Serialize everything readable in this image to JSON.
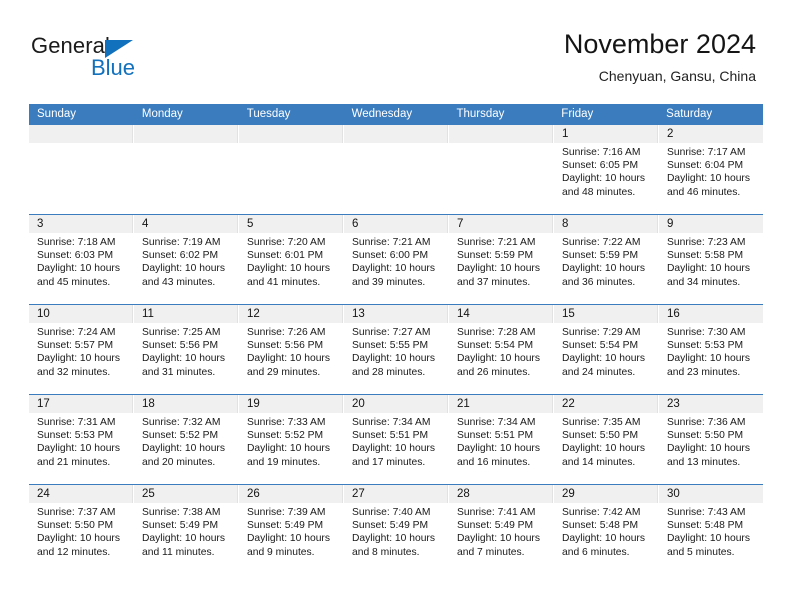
{
  "brand": {
    "name_part1": "General",
    "name_part2": "Blue",
    "accent_color": "#1271bd"
  },
  "header": {
    "title": "November 2024",
    "subtitle": "Chenyuan, Gansu, China"
  },
  "theme": {
    "header_bar_color": "#3a7cbe",
    "day_band_color": "#f0f0f0",
    "row_divider_color": "#3a7cbe"
  },
  "weekdays": [
    "Sunday",
    "Monday",
    "Tuesday",
    "Wednesday",
    "Thursday",
    "Friday",
    "Saturday"
  ],
  "weeks": [
    [
      {
        "day": "",
        "sunrise": "",
        "sunset": "",
        "daylight1": "",
        "daylight2": "",
        "empty": true
      },
      {
        "day": "",
        "sunrise": "",
        "sunset": "",
        "daylight1": "",
        "daylight2": "",
        "empty": true
      },
      {
        "day": "",
        "sunrise": "",
        "sunset": "",
        "daylight1": "",
        "daylight2": "",
        "empty": true
      },
      {
        "day": "",
        "sunrise": "",
        "sunset": "",
        "daylight1": "",
        "daylight2": "",
        "empty": true
      },
      {
        "day": "",
        "sunrise": "",
        "sunset": "",
        "daylight1": "",
        "daylight2": "",
        "empty": true
      },
      {
        "day": "1",
        "sunrise": "Sunrise: 7:16 AM",
        "sunset": "Sunset: 6:05 PM",
        "daylight1": "Daylight: 10 hours",
        "daylight2": "and 48 minutes."
      },
      {
        "day": "2",
        "sunrise": "Sunrise: 7:17 AM",
        "sunset": "Sunset: 6:04 PM",
        "daylight1": "Daylight: 10 hours",
        "daylight2": "and 46 minutes."
      }
    ],
    [
      {
        "day": "3",
        "sunrise": "Sunrise: 7:18 AM",
        "sunset": "Sunset: 6:03 PM",
        "daylight1": "Daylight: 10 hours",
        "daylight2": "and 45 minutes."
      },
      {
        "day": "4",
        "sunrise": "Sunrise: 7:19 AM",
        "sunset": "Sunset: 6:02 PM",
        "daylight1": "Daylight: 10 hours",
        "daylight2": "and 43 minutes."
      },
      {
        "day": "5",
        "sunrise": "Sunrise: 7:20 AM",
        "sunset": "Sunset: 6:01 PM",
        "daylight1": "Daylight: 10 hours",
        "daylight2": "and 41 minutes."
      },
      {
        "day": "6",
        "sunrise": "Sunrise: 7:21 AM",
        "sunset": "Sunset: 6:00 PM",
        "daylight1": "Daylight: 10 hours",
        "daylight2": "and 39 minutes."
      },
      {
        "day": "7",
        "sunrise": "Sunrise: 7:21 AM",
        "sunset": "Sunset: 5:59 PM",
        "daylight1": "Daylight: 10 hours",
        "daylight2": "and 37 minutes."
      },
      {
        "day": "8",
        "sunrise": "Sunrise: 7:22 AM",
        "sunset": "Sunset: 5:59 PM",
        "daylight1": "Daylight: 10 hours",
        "daylight2": "and 36 minutes."
      },
      {
        "day": "9",
        "sunrise": "Sunrise: 7:23 AM",
        "sunset": "Sunset: 5:58 PM",
        "daylight1": "Daylight: 10 hours",
        "daylight2": "and 34 minutes."
      }
    ],
    [
      {
        "day": "10",
        "sunrise": "Sunrise: 7:24 AM",
        "sunset": "Sunset: 5:57 PM",
        "daylight1": "Daylight: 10 hours",
        "daylight2": "and 32 minutes."
      },
      {
        "day": "11",
        "sunrise": "Sunrise: 7:25 AM",
        "sunset": "Sunset: 5:56 PM",
        "daylight1": "Daylight: 10 hours",
        "daylight2": "and 31 minutes."
      },
      {
        "day": "12",
        "sunrise": "Sunrise: 7:26 AM",
        "sunset": "Sunset: 5:56 PM",
        "daylight1": "Daylight: 10 hours",
        "daylight2": "and 29 minutes."
      },
      {
        "day": "13",
        "sunrise": "Sunrise: 7:27 AM",
        "sunset": "Sunset: 5:55 PM",
        "daylight1": "Daylight: 10 hours",
        "daylight2": "and 28 minutes."
      },
      {
        "day": "14",
        "sunrise": "Sunrise: 7:28 AM",
        "sunset": "Sunset: 5:54 PM",
        "daylight1": "Daylight: 10 hours",
        "daylight2": "and 26 minutes."
      },
      {
        "day": "15",
        "sunrise": "Sunrise: 7:29 AM",
        "sunset": "Sunset: 5:54 PM",
        "daylight1": "Daylight: 10 hours",
        "daylight2": "and 24 minutes."
      },
      {
        "day": "16",
        "sunrise": "Sunrise: 7:30 AM",
        "sunset": "Sunset: 5:53 PM",
        "daylight1": "Daylight: 10 hours",
        "daylight2": "and 23 minutes."
      }
    ],
    [
      {
        "day": "17",
        "sunrise": "Sunrise: 7:31 AM",
        "sunset": "Sunset: 5:53 PM",
        "daylight1": "Daylight: 10 hours",
        "daylight2": "and 21 minutes."
      },
      {
        "day": "18",
        "sunrise": "Sunrise: 7:32 AM",
        "sunset": "Sunset: 5:52 PM",
        "daylight1": "Daylight: 10 hours",
        "daylight2": "and 20 minutes."
      },
      {
        "day": "19",
        "sunrise": "Sunrise: 7:33 AM",
        "sunset": "Sunset: 5:52 PM",
        "daylight1": "Daylight: 10 hours",
        "daylight2": "and 19 minutes."
      },
      {
        "day": "20",
        "sunrise": "Sunrise: 7:34 AM",
        "sunset": "Sunset: 5:51 PM",
        "daylight1": "Daylight: 10 hours",
        "daylight2": "and 17 minutes."
      },
      {
        "day": "21",
        "sunrise": "Sunrise: 7:34 AM",
        "sunset": "Sunset: 5:51 PM",
        "daylight1": "Daylight: 10 hours",
        "daylight2": "and 16 minutes."
      },
      {
        "day": "22",
        "sunrise": "Sunrise: 7:35 AM",
        "sunset": "Sunset: 5:50 PM",
        "daylight1": "Daylight: 10 hours",
        "daylight2": "and 14 minutes."
      },
      {
        "day": "23",
        "sunrise": "Sunrise: 7:36 AM",
        "sunset": "Sunset: 5:50 PM",
        "daylight1": "Daylight: 10 hours",
        "daylight2": "and 13 minutes."
      }
    ],
    [
      {
        "day": "24",
        "sunrise": "Sunrise: 7:37 AM",
        "sunset": "Sunset: 5:50 PM",
        "daylight1": "Daylight: 10 hours",
        "daylight2": "and 12 minutes."
      },
      {
        "day": "25",
        "sunrise": "Sunrise: 7:38 AM",
        "sunset": "Sunset: 5:49 PM",
        "daylight1": "Daylight: 10 hours",
        "daylight2": "and 11 minutes."
      },
      {
        "day": "26",
        "sunrise": "Sunrise: 7:39 AM",
        "sunset": "Sunset: 5:49 PM",
        "daylight1": "Daylight: 10 hours",
        "daylight2": "and 9 minutes."
      },
      {
        "day": "27",
        "sunrise": "Sunrise: 7:40 AM",
        "sunset": "Sunset: 5:49 PM",
        "daylight1": "Daylight: 10 hours",
        "daylight2": "and 8 minutes."
      },
      {
        "day": "28",
        "sunrise": "Sunrise: 7:41 AM",
        "sunset": "Sunset: 5:49 PM",
        "daylight1": "Daylight: 10 hours",
        "daylight2": "and 7 minutes."
      },
      {
        "day": "29",
        "sunrise": "Sunrise: 7:42 AM",
        "sunset": "Sunset: 5:48 PM",
        "daylight1": "Daylight: 10 hours",
        "daylight2": "and 6 minutes."
      },
      {
        "day": "30",
        "sunrise": "Sunrise: 7:43 AM",
        "sunset": "Sunset: 5:48 PM",
        "daylight1": "Daylight: 10 hours",
        "daylight2": "and 5 minutes."
      }
    ]
  ]
}
